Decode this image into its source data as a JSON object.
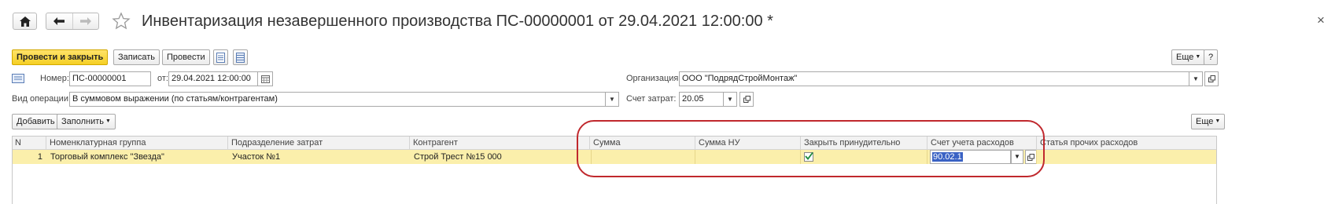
{
  "window": {
    "title": "Инвентаризация незавершенного производства ПС-00000001 от 29.04.2021 12:00:00 *",
    "close_glyph": "×"
  },
  "toolbar": {
    "post_close_label": "Провести и закрыть",
    "save_label": "Записать",
    "post_label": "Провести",
    "more_label": "Еще",
    "help_label": "?"
  },
  "header": {
    "number_label": "Номер:",
    "number_value": "ПС-00000001",
    "date_label": "от:",
    "date_value": "29.04.2021 12:00:00",
    "org_label": "Организация:",
    "org_value": "ООО \"ПодрядСтройМонтаж\"",
    "operation_label": "Вид операции:",
    "operation_value": "В суммовом выражении (по статьям/контрагентам)",
    "account_label": "Счет затрат:",
    "account_value": "20.05"
  },
  "table_toolbar": {
    "add_label": "Добавить",
    "fill_label": "Заполнить",
    "more_label": "Еще"
  },
  "table": {
    "columns": [
      "N",
      "Номенклатурная группа",
      "Подразделение затрат",
      "Контрагент",
      "Сумма",
      "Сумма НУ",
      "Закрыть принудительно",
      "Счет учета расходов",
      "Статья прочих расходов"
    ],
    "rows": [
      {
        "n": "1",
        "group": "Торговый комплекс \"Звезда\"",
        "division": "Участок №1",
        "contractor": "Строй Трест №15 000",
        "sum": "",
        "sum_nu": "",
        "force_close": true,
        "expense_account": "90.02.1",
        "other_expense": ""
      }
    ]
  },
  "colors": {
    "primary_button": "#f5cf24",
    "row_highlight": "#fbefab",
    "annotation": "#c0282d",
    "selection": "#3a62c4"
  }
}
